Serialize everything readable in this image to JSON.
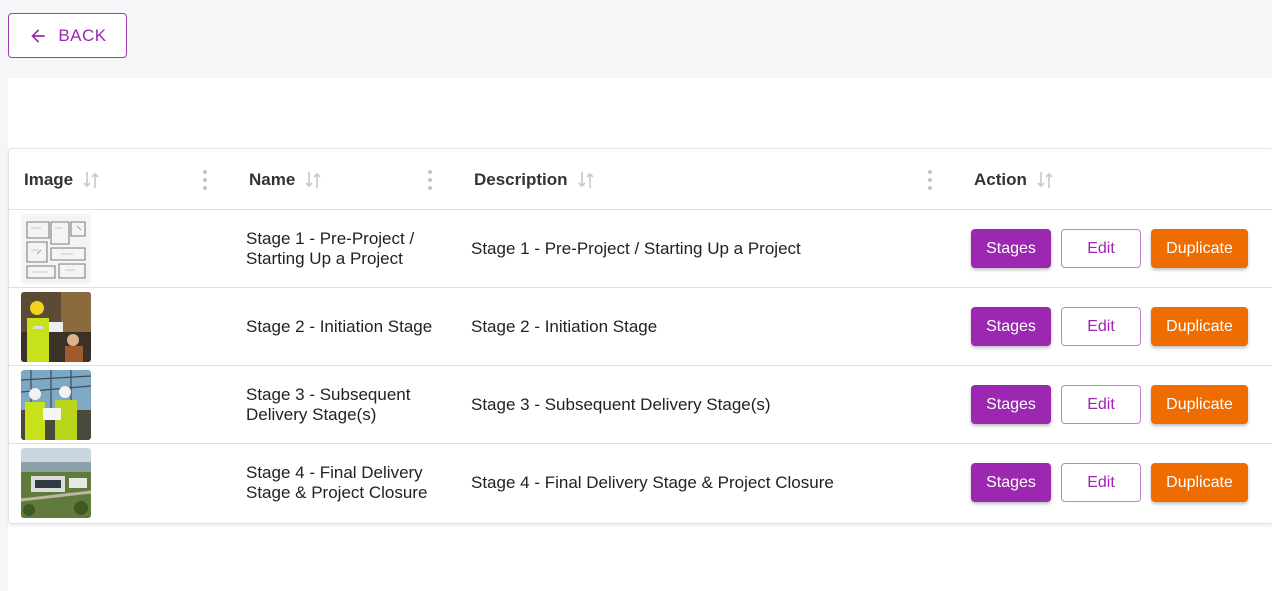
{
  "back_button": {
    "label": "BACK",
    "icon": "arrow-left-icon"
  },
  "table": {
    "columns": [
      {
        "label": "Image"
      },
      {
        "label": "Name"
      },
      {
        "label": "Description"
      },
      {
        "label": "Action"
      }
    ],
    "rows": [
      {
        "image": "floor-plan-thumbnail",
        "name": "Stage 1 - Pre-Project / Starting Up a Project",
        "description": "Stage 1 - Pre-Project / Starting Up a Project"
      },
      {
        "image": "construction-workers-thumbnail",
        "name": "Stage 2 - Initiation Stage",
        "description": "Stage 2 - Initiation Stage"
      },
      {
        "image": "engineers-site-thumbnail",
        "name": "Stage 3 - Subsequent Delivery Stage(s)",
        "description": "Stage 3 - Subsequent Delivery Stage(s)"
      },
      {
        "image": "aerial-site-thumbnail",
        "name": "Stage 4 - Final Delivery Stage & Project Closure",
        "description": "Stage 4 - Final Delivery Stage & Project Closure"
      }
    ],
    "actions": {
      "stages": "Stages",
      "edit": "Edit",
      "duplicate": "Duplicate"
    }
  },
  "colors": {
    "primary": "#9c27b0",
    "accent": "#ef6c00",
    "background": "#f6f6f9"
  }
}
